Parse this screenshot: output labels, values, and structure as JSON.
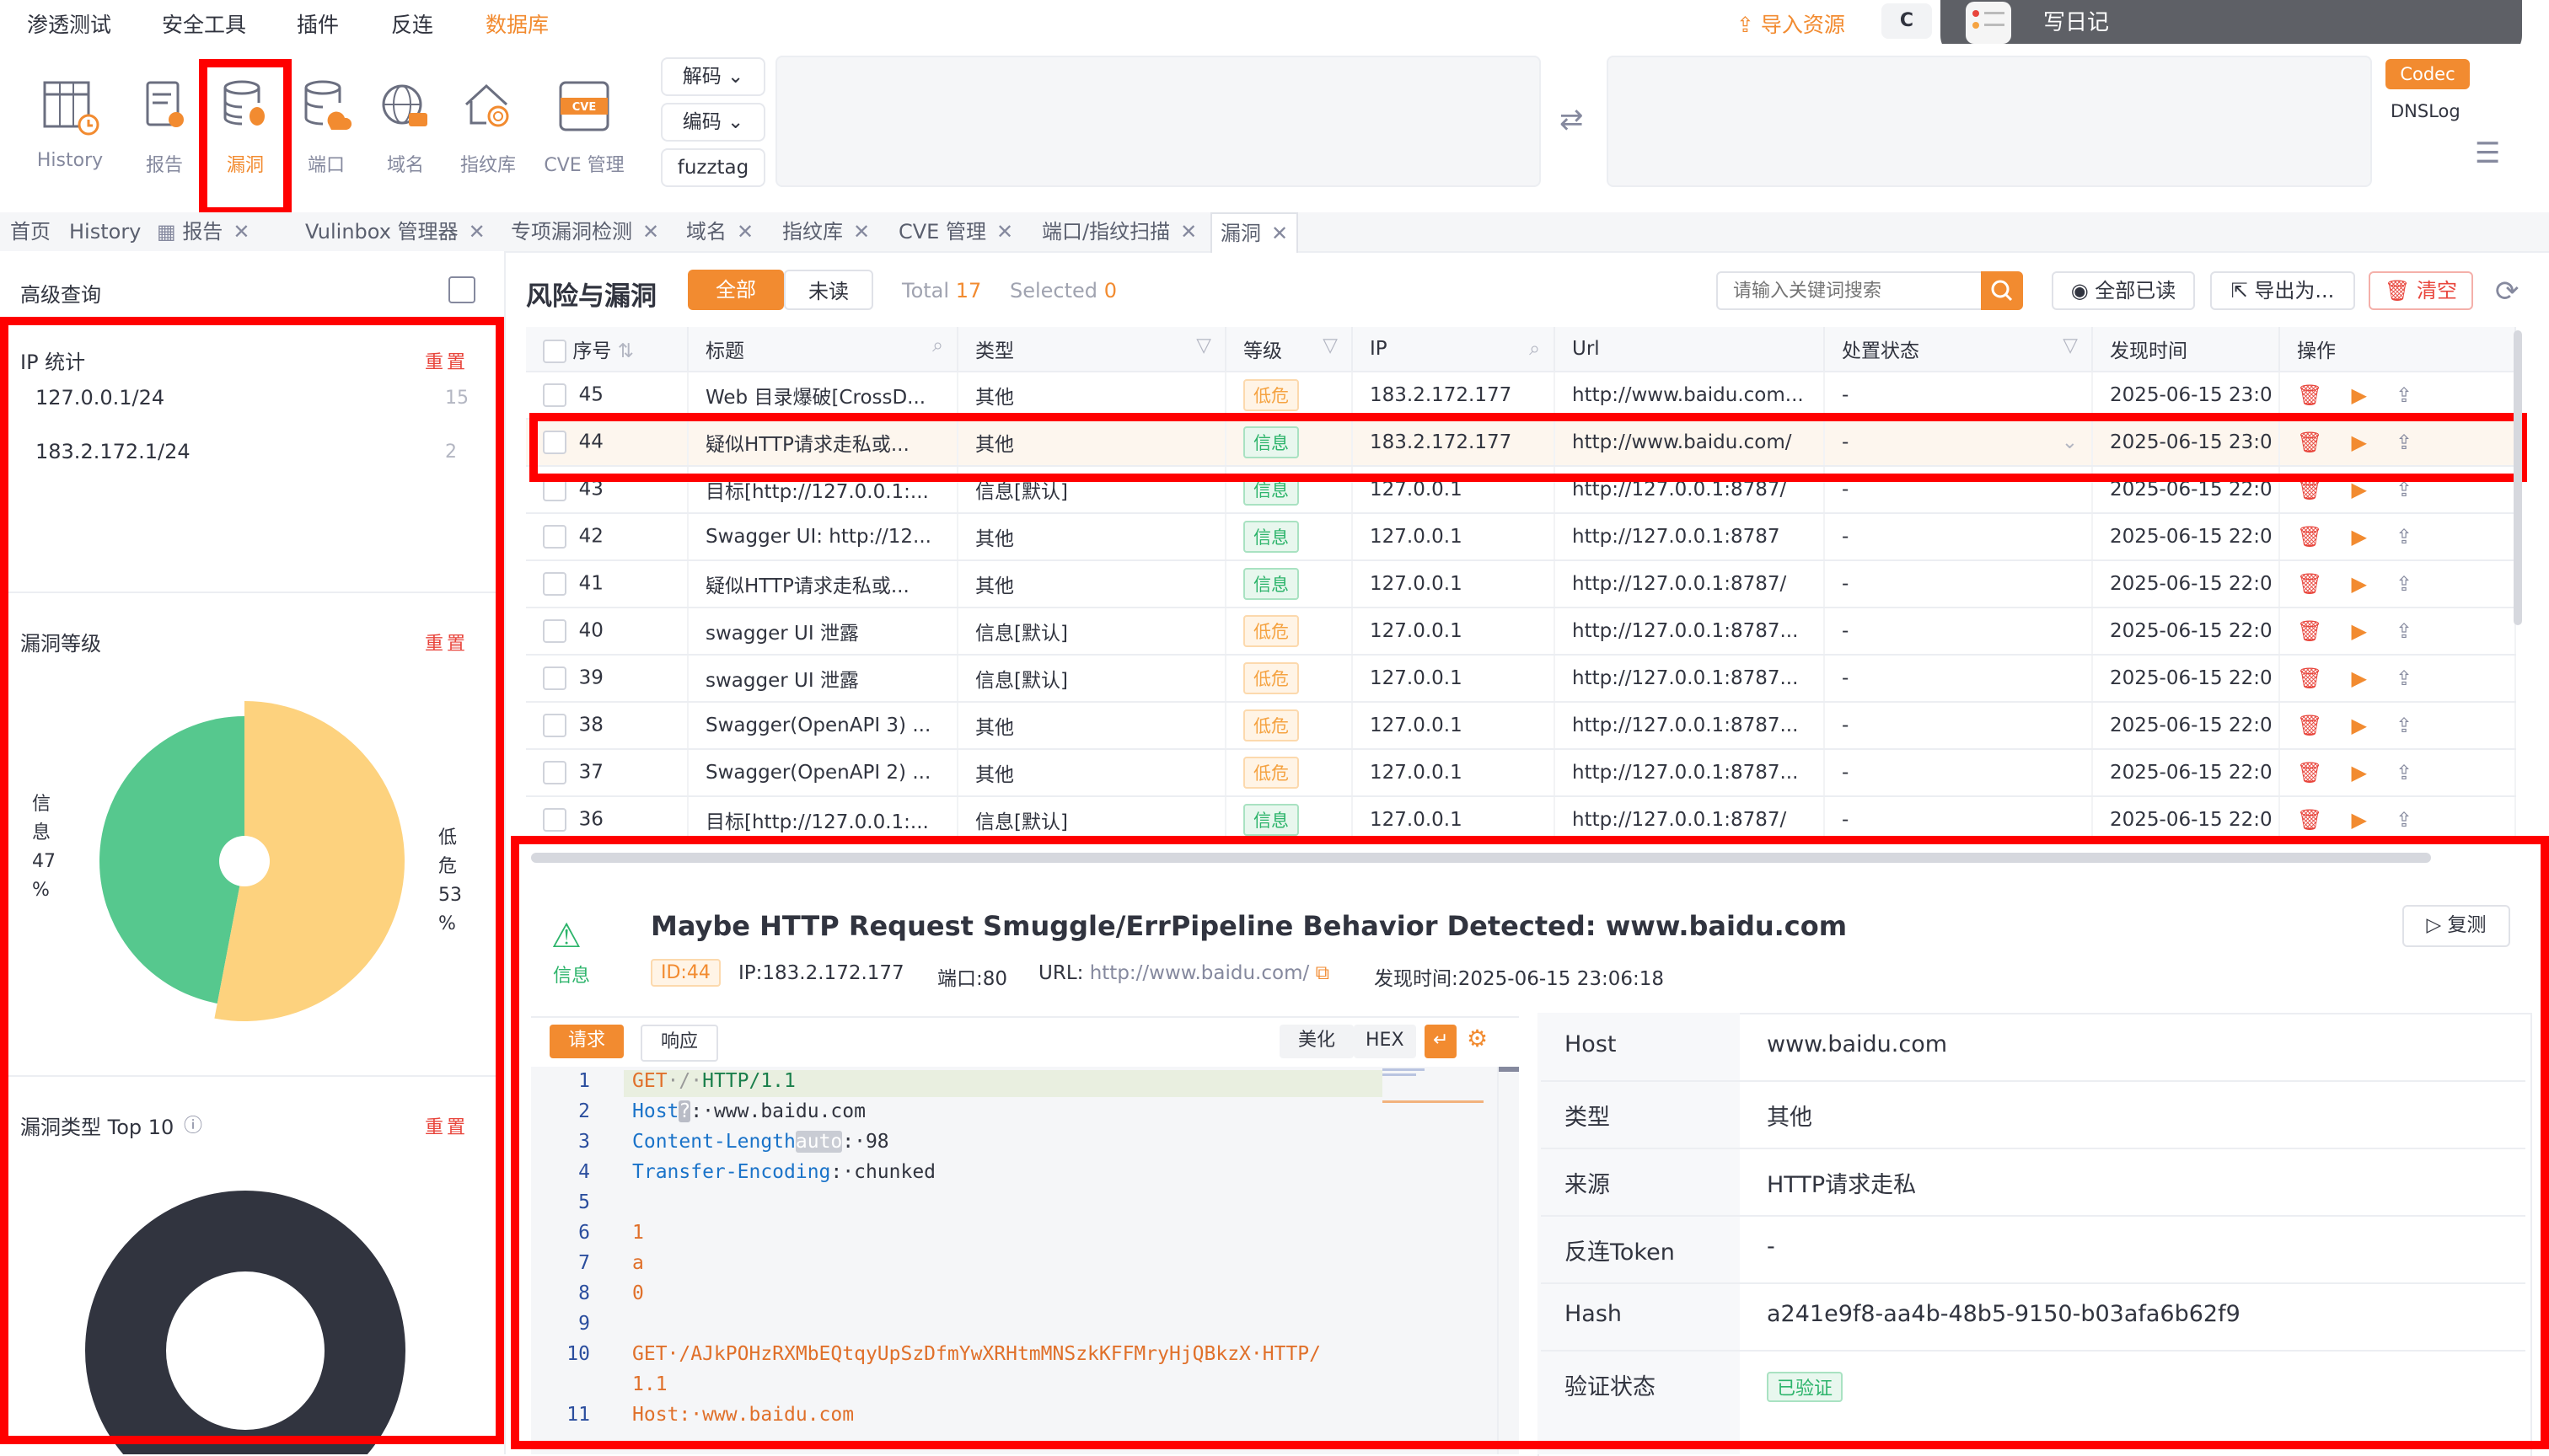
{
  "menu": {
    "items": [
      "渗透测试",
      "安全工具",
      "插件",
      "反连",
      "数据库"
    ],
    "active": "数据库",
    "import_label": "导入资源",
    "c_label": "C"
  },
  "notification": {
    "text": "写日记"
  },
  "toolbar": {
    "tools": [
      "History",
      "报告",
      "漏洞",
      "端口",
      "域名",
      "指纹库",
      "CVE 管理"
    ],
    "selected": "漏洞",
    "decode_label": "解码",
    "encode_label": "编码",
    "fuzztag_label": "fuzztag",
    "codec_label": "Codec",
    "dnslog_label": "DNSLog"
  },
  "tabs": [
    {
      "label": "首页",
      "close": false
    },
    {
      "label": "History",
      "close": false
    },
    {
      "label": "报告",
      "close": true
    },
    {
      "label": "Vulinbox 管理器",
      "close": true
    },
    {
      "label": "专项漏洞检测",
      "close": true
    },
    {
      "label": "域名",
      "close": true
    },
    {
      "label": "指纹库",
      "close": true
    },
    {
      "label": "CVE 管理",
      "close": true
    },
    {
      "label": "端口/指纹扫描",
      "close": true
    },
    {
      "label": "漏洞",
      "close": true,
      "active": true
    }
  ],
  "left": {
    "title": "高级查询",
    "ip_section": {
      "title": "IP 统计",
      "reset": "重置",
      "rows": [
        {
          "ip": "127.0.0.1/24",
          "count": "15"
        },
        {
          "ip": "183.2.172.1/24",
          "count": "2"
        }
      ]
    },
    "level_section": {
      "title": "漏洞等级",
      "reset": "重置",
      "info_label": "信息 47 %",
      "low_label": "低危 53 %",
      "info_lines": [
        "信",
        "息",
        "47",
        "%"
      ],
      "low_lines": [
        "低",
        "危",
        "53",
        "%"
      ]
    },
    "type_section": {
      "title": "漏洞类型 Top 10",
      "reset": "重置"
    }
  },
  "main": {
    "title": "风险与漏洞",
    "seg_all": "全部",
    "seg_unread": "未读",
    "total_label": "Total",
    "total_value": "17",
    "selected_label": "Selected",
    "selected_value": "0",
    "search_placeholder": "请输入关键词搜索",
    "read_all": "全部已读",
    "export": "导出为...",
    "clear": "清空",
    "columns": [
      "序号",
      "标题",
      "类型",
      "等级",
      "IP",
      "Url",
      "处置状态",
      "发现时间",
      "操作"
    ],
    "rows": [
      {
        "id": "45",
        "title": "Web 目录爆破[CrossD...",
        "type": "其他",
        "level": "低危",
        "level_kind": "low",
        "ip": "183.2.172.177",
        "url": "http://www.baidu.com...",
        "status": "-",
        "time": "2025-06-15 23:0"
      },
      {
        "id": "44",
        "title": "疑似HTTP请求走私或...",
        "type": "其他",
        "level": "信息",
        "level_kind": "info",
        "ip": "183.2.172.177",
        "url": "http://www.baidu.com/",
        "status": "-",
        "time": "2025-06-15 23:0"
      },
      {
        "id": "43",
        "title": "目标[http://127.0.0.1:...",
        "type": "信息[默认]",
        "level": "信息",
        "level_kind": "info",
        "ip": "127.0.0.1",
        "url": "http://127.0.0.1:8787/",
        "status": "-",
        "time": "2025-06-15 22:0"
      },
      {
        "id": "42",
        "title": "Swagger UI: http://12...",
        "type": "其他",
        "level": "信息",
        "level_kind": "info",
        "ip": "127.0.0.1",
        "url": "http://127.0.0.1:8787",
        "status": "-",
        "time": "2025-06-15 22:0"
      },
      {
        "id": "41",
        "title": "疑似HTTP请求走私或...",
        "type": "其他",
        "level": "信息",
        "level_kind": "info",
        "ip": "127.0.0.1",
        "url": "http://127.0.0.1:8787/",
        "status": "-",
        "time": "2025-06-15 22:0"
      },
      {
        "id": "40",
        "title": "swagger UI 泄露",
        "type": "信息[默认]",
        "level": "低危",
        "level_kind": "low",
        "ip": "127.0.0.1",
        "url": "http://127.0.0.1:8787...",
        "status": "-",
        "time": "2025-06-15 22:0"
      },
      {
        "id": "39",
        "title": "swagger UI 泄露",
        "type": "信息[默认]",
        "level": "低危",
        "level_kind": "low",
        "ip": "127.0.0.1",
        "url": "http://127.0.0.1:8787...",
        "status": "-",
        "time": "2025-06-15 22:0"
      },
      {
        "id": "38",
        "title": "Swagger(OpenAPI 3) ...",
        "type": "其他",
        "level": "低危",
        "level_kind": "low",
        "ip": "127.0.0.1",
        "url": "http://127.0.0.1:8787...",
        "status": "-",
        "time": "2025-06-15 22:0"
      },
      {
        "id": "37",
        "title": "Swagger(OpenAPI 2) ...",
        "type": "其他",
        "level": "低危",
        "level_kind": "low",
        "ip": "127.0.0.1",
        "url": "http://127.0.0.1:8787...",
        "status": "-",
        "time": "2025-06-15 22:0"
      },
      {
        "id": "36",
        "title": "目标[http://127.0.0.1:...",
        "type": "信息[默认]",
        "level": "信息",
        "level_kind": "info",
        "ip": "127.0.0.1",
        "url": "http://127.0.0.1:8787/",
        "status": "-",
        "time": "2025-06-15 22:0"
      }
    ]
  },
  "detail": {
    "level": "信息",
    "title": "Maybe HTTP Request Smuggle/ErrPipeline Behavior Detected: www.baidu.com",
    "retest": "复测",
    "id_badge": "ID:44",
    "ip": "IP:183.2.172.177",
    "port": "端口:80",
    "url_label": "URL:",
    "url": "http://www.baidu.com/",
    "found": "发现时间:2025-06-15 23:06:18",
    "req_tab": "请求",
    "resp_tab": "响应",
    "beautify": "美化",
    "hex": "HEX",
    "code_lines": [
      {
        "n": "1",
        "parts": [
          {
            "t": "GET",
            "c": "#e0702a"
          },
          {
            "t": "·/·",
            "c": "#999"
          },
          {
            "t": "HTTP/1.1",
            "c": "#1a7f4b"
          }
        ]
      },
      {
        "n": "2",
        "parts": [
          {
            "t": "Host",
            "c": "#1a73c9"
          },
          {
            "t": "?",
            "c": "#fff",
            "bg": "#b9bcc6"
          },
          {
            "t": ":·www.baidu.com",
            "c": "#31343f"
          }
        ]
      },
      {
        "n": "3",
        "parts": [
          {
            "t": "Content-Length",
            "c": "#1a73c9"
          },
          {
            "t": "auto",
            "c": "#fff",
            "bg": "#c9ccd4"
          },
          {
            "t": ":·98",
            "c": "#31343f"
          }
        ]
      },
      {
        "n": "4",
        "parts": [
          {
            "t": "Transfer-Encoding",
            "c": "#1a73c9"
          },
          {
            "t": ":·chunked",
            "c": "#31343f"
          }
        ]
      },
      {
        "n": "5",
        "parts": []
      },
      {
        "n": "6",
        "parts": [
          {
            "t": "1",
            "c": "#e0702a"
          }
        ]
      },
      {
        "n": "7",
        "parts": [
          {
            "t": "a",
            "c": "#e0702a"
          }
        ]
      },
      {
        "n": "8",
        "parts": [
          {
            "t": "0",
            "c": "#e0702a"
          }
        ]
      },
      {
        "n": "9",
        "parts": []
      },
      {
        "n": "10",
        "parts": [
          {
            "t": "GET·/AJkPOHzRXMbEQtqyUpSzDfmYwXRHtmMNSzkKFFMryHjQBkzX·HTTP/",
            "c": "#e0702a"
          }
        ]
      },
      {
        "n": "",
        "parts": [
          {
            "t": "1.1",
            "c": "#e0702a"
          }
        ]
      },
      {
        "n": "11",
        "parts": [
          {
            "t": "Host:·www.baidu.com",
            "c": "#e0702a"
          }
        ]
      }
    ],
    "props": [
      {
        "k": "Host",
        "v": "www.baidu.com"
      },
      {
        "k": "类型",
        "v": "其他"
      },
      {
        "k": "来源",
        "v": "HTTP请求走私"
      },
      {
        "k": "反连Token",
        "v": "-"
      },
      {
        "k": "Hash",
        "v": "a241e9f8-aa4b-48b5-9150-b03afa6b62f9"
      },
      {
        "k": "验证状态",
        "v": "已验证"
      }
    ]
  },
  "chart_data": {
    "type": "pie",
    "title": "漏洞等级",
    "categories": [
      "信息",
      "低危"
    ],
    "values": [
      47,
      53
    ],
    "colors": [
      "#56c88e",
      "#fdd27e"
    ]
  }
}
